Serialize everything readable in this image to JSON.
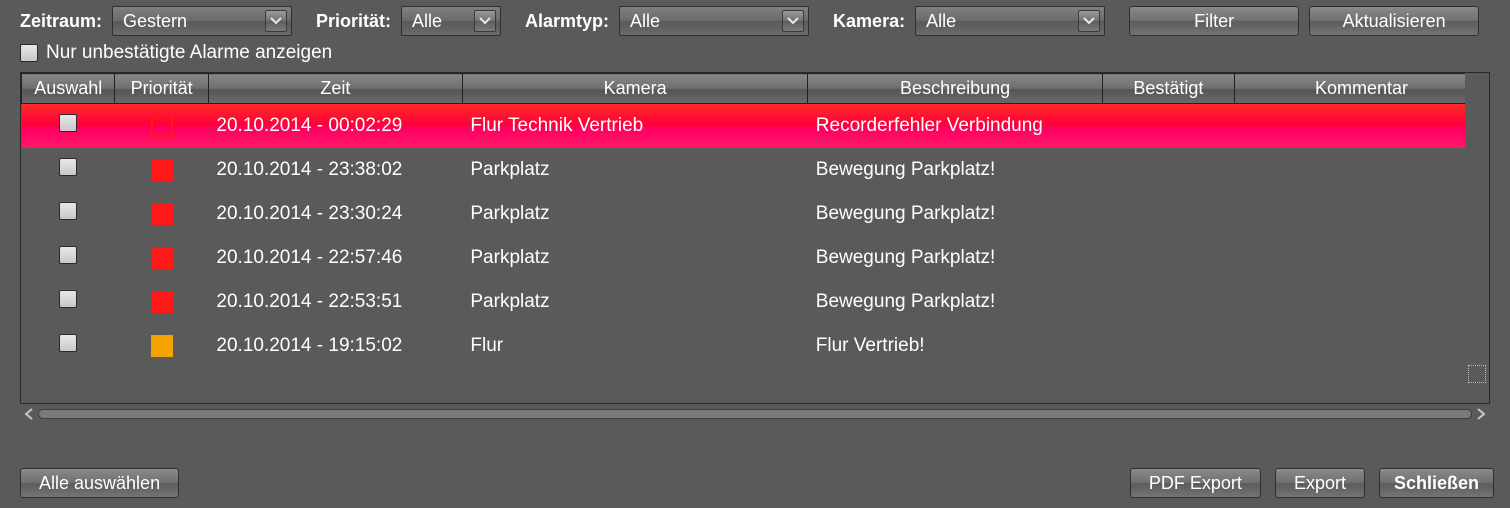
{
  "filters": {
    "zeitraum_label": "Zeitraum:",
    "zeitraum_value": "Gestern",
    "prioritaet_label": "Priorität:",
    "prioritaet_value": "Alle",
    "alarmtyp_label": "Alarmtyp:",
    "alarmtyp_value": "Alle",
    "kamera_label": "Kamera:",
    "kamera_value": "Alle",
    "filter_btn": "Filter",
    "refresh_btn": "Aktualisieren",
    "only_unconfirmed_label": "Nur unbestätigte Alarme anzeigen"
  },
  "table": {
    "headers": {
      "auswahl": "Auswahl",
      "prioritaet": "Priorität",
      "zeit": "Zeit",
      "kamera": "Kamera",
      "beschreibung": "Beschreibung",
      "bestaetigt": "Bestätigt",
      "kommentar": "Kommentar"
    },
    "rows": [
      {
        "highlight": true,
        "priority_style": "redout",
        "zeit": "20.10.2014 - 00:02:29",
        "kamera": "Flur Technik Vertrieb",
        "beschreibung": "Recorderfehler  Verbindung",
        "bestaetigt": "",
        "kommentar": ""
      },
      {
        "highlight": false,
        "priority_style": "red",
        "zeit": "20.10.2014 - 23:38:02",
        "kamera": "Parkplatz",
        "beschreibung": "Bewegung Parkplatz!",
        "bestaetigt": "",
        "kommentar": ""
      },
      {
        "highlight": false,
        "priority_style": "red",
        "zeit": "20.10.2014 - 23:30:24",
        "kamera": "Parkplatz",
        "beschreibung": "Bewegung Parkplatz!",
        "bestaetigt": "",
        "kommentar": ""
      },
      {
        "highlight": false,
        "priority_style": "red",
        "zeit": "20.10.2014 - 22:57:46",
        "kamera": "Parkplatz",
        "beschreibung": "Bewegung Parkplatz!",
        "bestaetigt": "",
        "kommentar": ""
      },
      {
        "highlight": false,
        "priority_style": "red",
        "zeit": "20.10.2014 - 22:53:51",
        "kamera": "Parkplatz",
        "beschreibung": "Bewegung Parkplatz!",
        "bestaetigt": "",
        "kommentar": ""
      },
      {
        "highlight": false,
        "priority_style": "orange",
        "zeit": "20.10.2014 - 19:15:02",
        "kamera": "Flur",
        "beschreibung": "Flur Vertrieb!",
        "bestaetigt": "",
        "kommentar": ""
      }
    ]
  },
  "footer": {
    "select_all": "Alle auswählen",
    "pdf_export": "PDF Export",
    "export": "Export",
    "close": "Schließen"
  }
}
